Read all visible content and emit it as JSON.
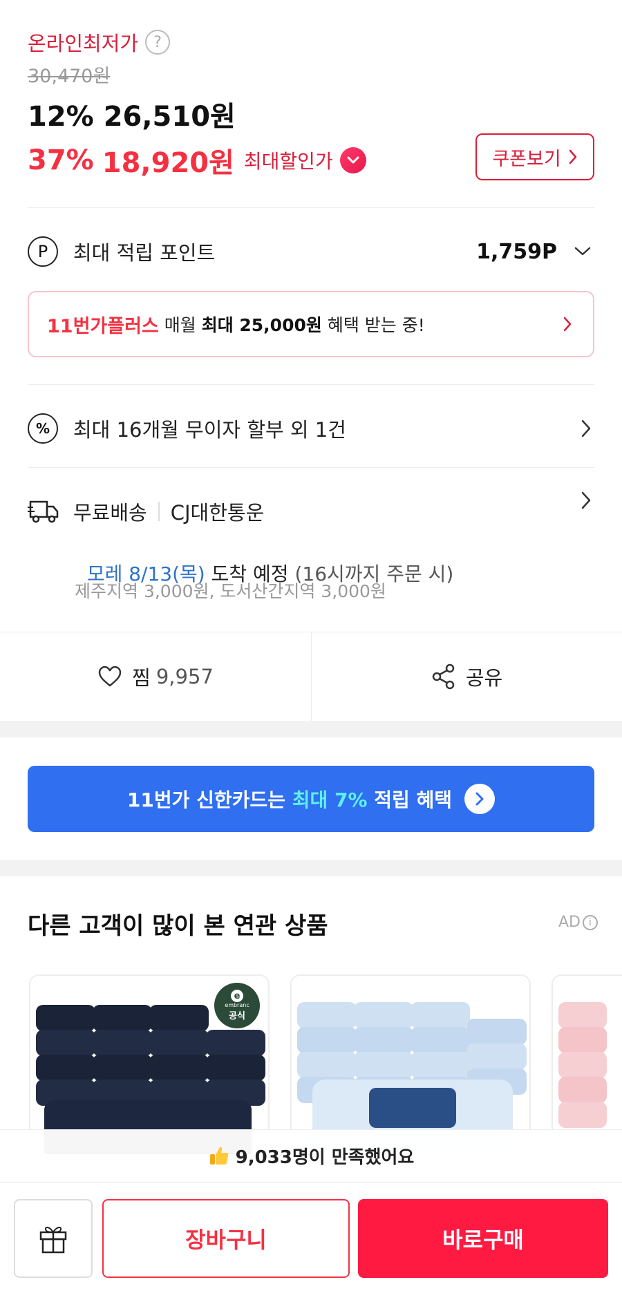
{
  "price": {
    "online_lowest_label": "온라인최저가",
    "help": "?",
    "original": "30,470원",
    "discount1_rate": "12%",
    "discount1_price": "26,510원",
    "discount2_rate": "37%",
    "discount2_price": "18,920원",
    "max_discount_label": "최대할인가",
    "coupon_button": "쿠폰보기"
  },
  "points": {
    "label": "최대 적립 포인트",
    "value": "1,759P"
  },
  "plus_banner": {
    "brand": "11번가플러스",
    "text1": " 매월 ",
    "strong": "최대 25,000원",
    "text2": " 혜택 받는 중!"
  },
  "installment": {
    "label": "최대 16개월 무이자 할부 외 1건"
  },
  "shipping": {
    "free": "무료배송",
    "carrier": "CJ대한통운",
    "arrival_date": "모레 8/13(목)",
    "arrival_text": " 도착 예정",
    "arrival_note": " (16시까지 주문 시)",
    "extra": "제주지역 3,000원, 도서산간지역 3,000원"
  },
  "actions": {
    "like_label": "찜",
    "like_count": "9,957",
    "share_label": "공유"
  },
  "card_banner": {
    "text1": "11번가 신한카드는 ",
    "highlight": "최대 7%",
    "text2": " 적립 혜택"
  },
  "related": {
    "title": "다른 고객이 많이 본 연관 상품",
    "ad": "AD",
    "badge": "공식",
    "badge_brand": "embranc"
  },
  "satisfaction": {
    "text": "9,033명이 만족했어요"
  },
  "bottom_bar": {
    "cart": "장바구니",
    "buy": "바로구매"
  },
  "colors": {
    "brand_red": "#f43142",
    "dark_red": "#d81e3a",
    "blue_banner": "#2f6ff0",
    "arrival_blue": "#2e72c8",
    "highlight_cyan": "#5df0f0"
  }
}
